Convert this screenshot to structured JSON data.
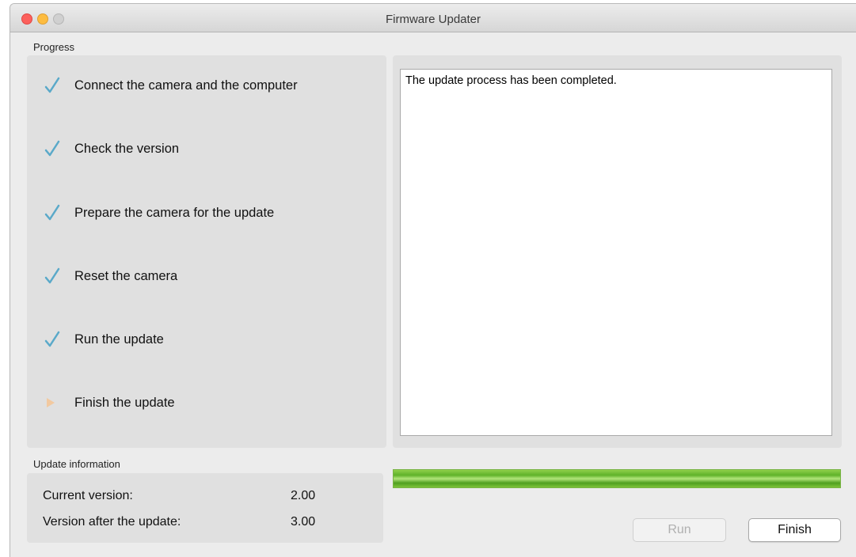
{
  "window": {
    "title": "Firmware Updater"
  },
  "progress": {
    "label": "Progress",
    "steps": [
      {
        "label": "Connect the camera and the computer",
        "status": "done",
        "icon": "checkmark-icon"
      },
      {
        "label": "Check the version",
        "status": "done",
        "icon": "checkmark-icon"
      },
      {
        "label": "Prepare the camera for the update",
        "status": "done",
        "icon": "checkmark-icon"
      },
      {
        "label": "Reset the camera",
        "status": "done",
        "icon": "checkmark-icon"
      },
      {
        "label": "Run the update",
        "status": "done",
        "icon": "checkmark-icon"
      },
      {
        "label": "Finish the update",
        "status": "current",
        "icon": "play-arrow-icon"
      }
    ]
  },
  "log": {
    "text": "The update process has been completed."
  },
  "update_info": {
    "label": "Update information",
    "current_label": "Current version:",
    "current_value": "2.00",
    "after_label": "Version after the update:",
    "after_value": "3.00"
  },
  "progress_bar": {
    "fraction": 1.0
  },
  "buttons": {
    "run_label": "Run",
    "run_enabled": false,
    "finish_label": "Finish"
  },
  "colors": {
    "check": "#5aa9c9",
    "current_arrow": "#f2c9a0",
    "progress_green": "#5fb22a"
  }
}
